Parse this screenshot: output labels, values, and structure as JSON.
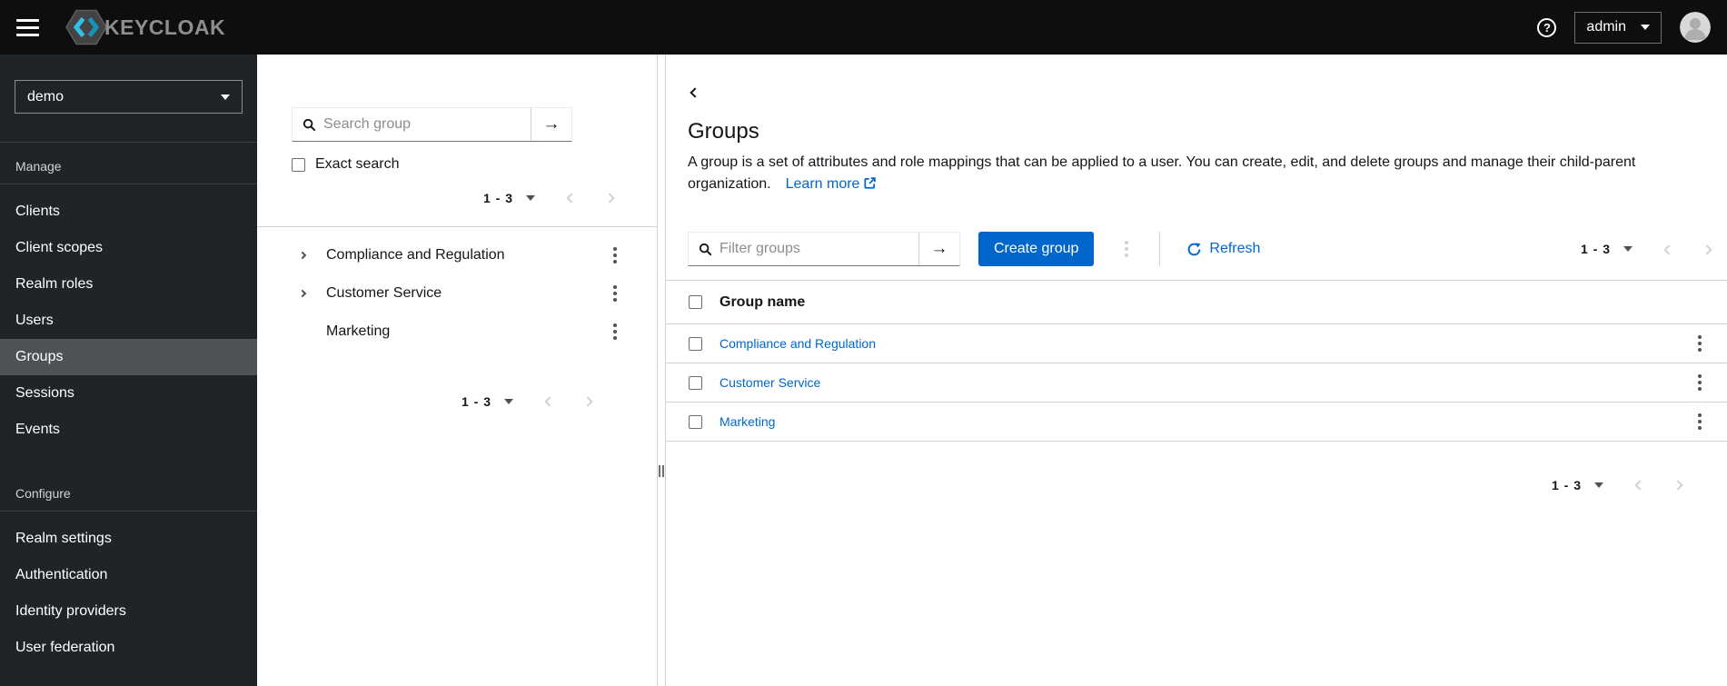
{
  "header": {
    "brand": "KEYCLOAK",
    "user_menu": "admin"
  },
  "icons": {
    "help_glyph": "?",
    "submit_arrow": "→"
  },
  "sidebar": {
    "realm": "demo",
    "sections": [
      {
        "label": "Manage",
        "items": [
          "Clients",
          "Client scopes",
          "Realm roles",
          "Users",
          "Groups",
          "Sessions",
          "Events"
        ],
        "active_item": "Groups"
      },
      {
        "label": "Configure",
        "items": [
          "Realm settings",
          "Authentication",
          "Identity providers",
          "User federation"
        ]
      }
    ]
  },
  "tree_panel": {
    "search_placeholder": "Search group",
    "exact_search_label": "Exact search",
    "pagination_top": {
      "range": "1 - 3"
    },
    "items": [
      {
        "name": "Compliance and Regulation",
        "expandable": true
      },
      {
        "name": "Customer Service",
        "expandable": true
      },
      {
        "name": "Marketing",
        "expandable": false
      }
    ],
    "pagination_bottom": {
      "range": "1 - 3"
    }
  },
  "main": {
    "title": "Groups",
    "description": "A group is a set of attributes and role mappings that can be applied to a user. You can create, edit, and delete groups and manage their child-parent organization.",
    "learn_more_label": "Learn more",
    "toolbar": {
      "filter_placeholder": "Filter groups",
      "create_button": "Create group",
      "refresh_label": "Refresh",
      "pagination": {
        "range": "1 - 3"
      }
    },
    "table": {
      "header": "Group name",
      "rows": [
        {
          "name": "Compliance and Regulation"
        },
        {
          "name": "Customer Service"
        },
        {
          "name": "Marketing"
        }
      ]
    },
    "pagination_bottom": {
      "range": "1 - 3"
    }
  },
  "colors": {
    "accent_blue": "#0066cc",
    "masthead_bg": "#0e0e0e",
    "sidebar_bg": "#212427",
    "sidebar_active_bg": "#4f5255",
    "border_gray": "#d2d2d2",
    "disabled_gray": "#d2d2d2",
    "logo_cyan": "#32c0e7"
  }
}
